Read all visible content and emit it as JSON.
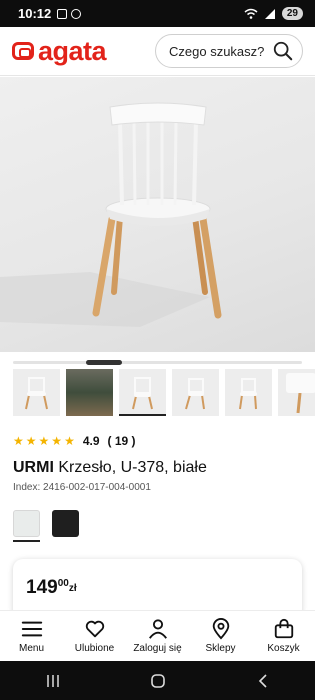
{
  "status_bar": {
    "time": "10:12",
    "battery": "29"
  },
  "header": {
    "logo": "agata",
    "search_placeholder": "Czego szukasz?"
  },
  "product": {
    "brand": "URMI",
    "name": "Krzesło, U-378, białe",
    "index": "Index: 2416-002-017-004-0001",
    "rating": "4.9",
    "rating_count": "( 19 )",
    "stars": 5,
    "price_int": "149",
    "price_dec": "00",
    "currency": "zł",
    "colors": [
      {
        "name": "white",
        "hex": "#e9eceb"
      },
      {
        "name": "black",
        "hex": "#1f1f1f"
      }
    ]
  },
  "gallery": {
    "thumbnail_count": 6,
    "active_index": 2
  },
  "nav": {
    "items": [
      {
        "label": "Menu",
        "icon": "menu-icon"
      },
      {
        "label": "Ulubione",
        "icon": "heart-icon"
      },
      {
        "label": "Zaloguj się",
        "icon": "user-icon"
      },
      {
        "label": "Sklepy",
        "icon": "location-pin-icon"
      },
      {
        "label": "Koszyk",
        "icon": "shopping-bag-icon"
      }
    ]
  },
  "colors": {
    "brand": "#e2231a",
    "star": "#f4b400"
  }
}
